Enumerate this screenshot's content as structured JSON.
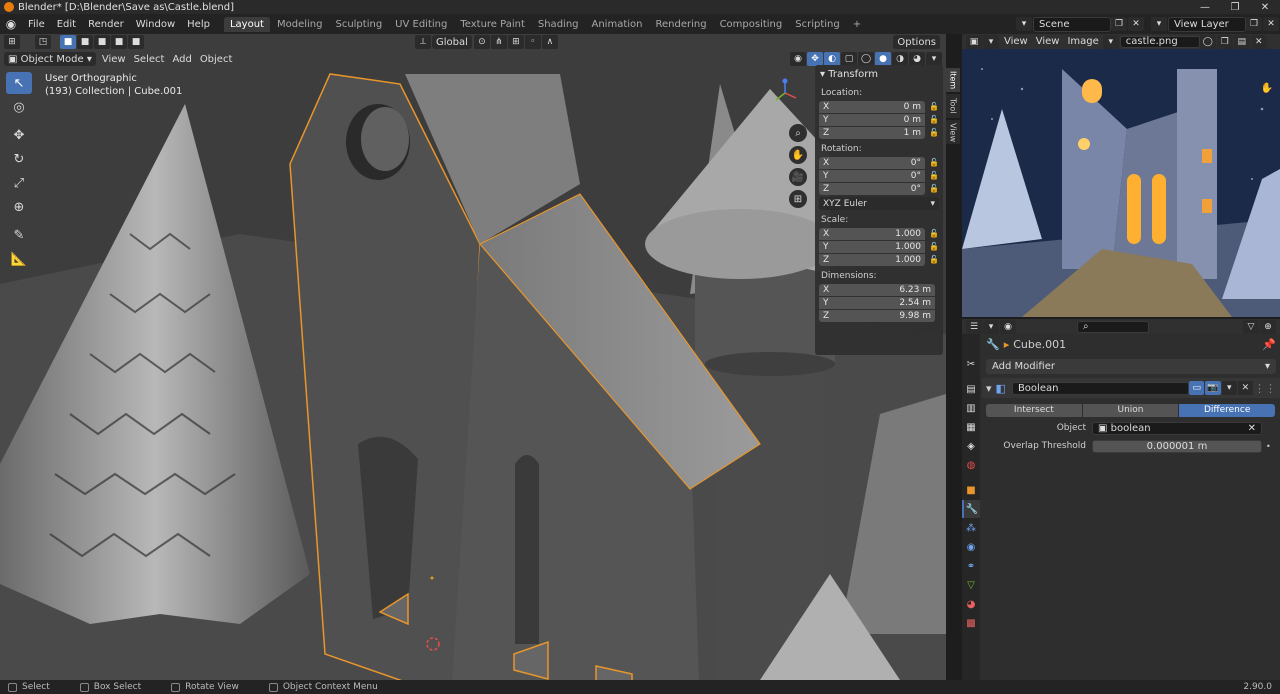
{
  "window": {
    "title": "Blender* [D:\\Blender\\Save as\\Castle.blend]",
    "controls": [
      "—",
      "❐",
      "✕"
    ]
  },
  "menu": [
    "File",
    "Edit",
    "Render",
    "Window",
    "Help"
  ],
  "workspaces": [
    {
      "label": "Layout",
      "active": true
    },
    {
      "label": "Modeling"
    },
    {
      "label": "Sculpting"
    },
    {
      "label": "UV Editing"
    },
    {
      "label": "Texture Paint"
    },
    {
      "label": "Shading"
    },
    {
      "label": "Animation"
    },
    {
      "label": "Rendering"
    },
    {
      "label": "Compositing"
    },
    {
      "label": "Scripting"
    }
  ],
  "scene": {
    "name": "Scene",
    "view_layer": "View Layer"
  },
  "viewport": {
    "orientation": "Global",
    "options": "Options",
    "mode": "Object Mode",
    "menus": [
      "View",
      "Select",
      "Add",
      "Object"
    ],
    "info_line1": "User Orthographic",
    "info_line2": "(193) Collection | Cube.001"
  },
  "transform": {
    "title": "Transform",
    "location_label": "Location:",
    "location": [
      {
        "axis": "X",
        "value": "0 m"
      },
      {
        "axis": "Y",
        "value": "0 m"
      },
      {
        "axis": "Z",
        "value": "1 m"
      }
    ],
    "rotation_label": "Rotation:",
    "rotation": [
      {
        "axis": "X",
        "value": "0°"
      },
      {
        "axis": "Y",
        "value": "0°"
      },
      {
        "axis": "Z",
        "value": "0°"
      }
    ],
    "rotation_mode": "XYZ Euler",
    "scale_label": "Scale:",
    "scale": [
      {
        "axis": "X",
        "value": "1.000"
      },
      {
        "axis": "Y",
        "value": "1.000"
      },
      {
        "axis": "Z",
        "value": "1.000"
      }
    ],
    "dimensions_label": "Dimensions:",
    "dimensions": [
      {
        "axis": "X",
        "value": "6.23 m"
      },
      {
        "axis": "Y",
        "value": "2.54 m"
      },
      {
        "axis": "Z",
        "value": "9.98 m"
      }
    ]
  },
  "npanel_tabs": [
    "Item",
    "Tool",
    "View"
  ],
  "image_editor": {
    "menus": [
      "View",
      "View",
      "Image"
    ],
    "image": "castle.png"
  },
  "properties": {
    "object": "Cube.001",
    "add_modifier": "Add Modifier",
    "modifier_name": "Boolean",
    "operations": [
      {
        "label": "Intersect"
      },
      {
        "label": "Union"
      },
      {
        "label": "Difference",
        "active": true
      }
    ],
    "object_label": "Object",
    "object_value": "boolean",
    "overlap_label": "Overlap Threshold",
    "overlap_value": "0.000001 m"
  },
  "status": {
    "select": "Select",
    "box_select": "Box Select",
    "rotate": "Rotate View",
    "context_menu": "Object Context Menu",
    "version": "2.90.0"
  },
  "colors": {
    "accent": "#4772b3",
    "selection": "#e8962b"
  }
}
